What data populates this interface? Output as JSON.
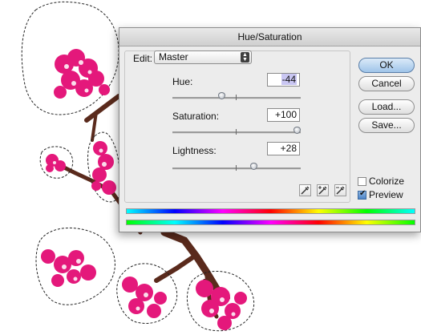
{
  "dialog": {
    "title": "Hue/Saturation",
    "edit_label": "Edit:",
    "edit_value": "Master",
    "hue": {
      "label": "Hue:",
      "value": "-44",
      "slider_fraction": 0.38
    },
    "saturation": {
      "label": "Saturation:",
      "value": "+100",
      "slider_fraction": 1.0
    },
    "lightness": {
      "label": "Lightness:",
      "value": "+28",
      "slider_fraction": 0.64
    },
    "buttons": {
      "ok": "OK",
      "cancel": "Cancel",
      "load": "Load...",
      "save": "Save..."
    },
    "colorize": {
      "label": "Colorize",
      "checked": false
    },
    "preview": {
      "label": "Preview",
      "checked": true
    },
    "eyedroppers": [
      "eyedropper-icon",
      "eyedropper-plus-icon",
      "eyedropper-minus-icon"
    ]
  },
  "colors": {
    "blossom": "#e4187b",
    "branch": "#5a2a1c",
    "default_button": "#9fc4e9"
  }
}
